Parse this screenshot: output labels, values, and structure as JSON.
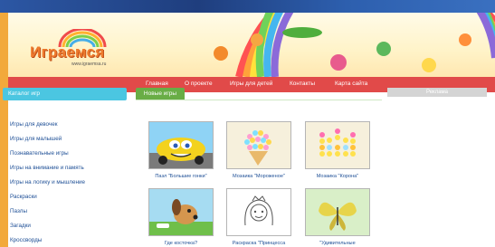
{
  "site": {
    "logo_text": "Играемся",
    "logo_url": "www.igraemsa.ru"
  },
  "nav": {
    "items": [
      "Главная",
      "О проекте",
      "Игры для детей",
      "Контакты",
      "Карта сайта"
    ]
  },
  "sidebar": {
    "title": "Каталог игр",
    "items": [
      "Игры для девочек",
      "Игры для малышей",
      "Познавательные игры",
      "Игры на внимание и память",
      "Игры на логику и мышление",
      "Раскраски",
      "Пазлы",
      "Загадки",
      "Кроссворды"
    ]
  },
  "main": {
    "section_title": "Новые игры",
    "games": [
      {
        "caption": "Пазл \"Большие гонки\""
      },
      {
        "caption": "Мозаика \"Мороженое\""
      },
      {
        "caption": "Мозаика \"Корона\""
      },
      {
        "caption": "Где косточка?"
      },
      {
        "caption": "Раскраска \"Принцесса"
      },
      {
        "caption": "\"Удивительные"
      }
    ]
  },
  "ad": {
    "label": "Реклама"
  },
  "colors": {
    "nav": "#e14a49",
    "catalog_header": "#4bc6e1",
    "new_games": "#69ad46",
    "link": "#1e4f96"
  }
}
